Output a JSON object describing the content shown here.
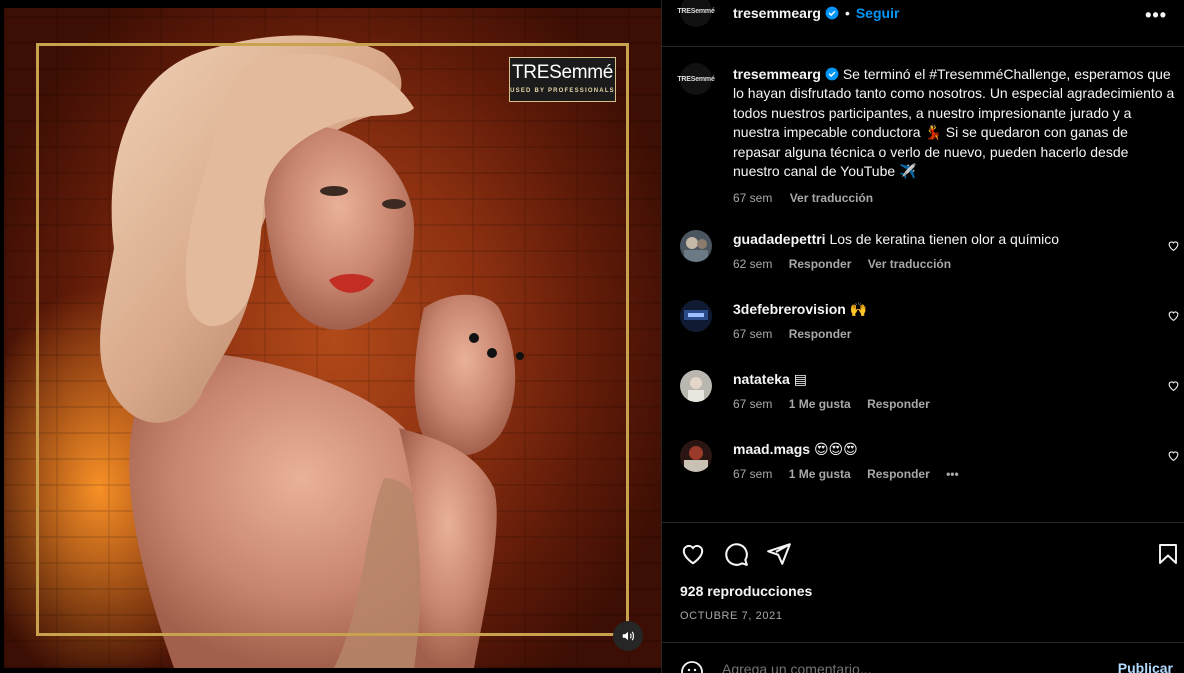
{
  "post": {
    "brand_logo_text": "TRESemmé",
    "brand_logo_tag": "USED BY PROFESSIONALS",
    "username": "tresemmearg",
    "follow_label": "Seguir",
    "more_label": "•••",
    "avatar_text": "TRESemmé"
  },
  "caption": {
    "username": "tresemmearg",
    "text": "Se terminó el #TresemméChallenge, esperamos que lo hayan disfrutado tanto como nosotros. Un especial agradecimiento a todos nuestros participantes, a nuestro impresionante jurado y a nuestra impecable conductora 💃 Si se quedaron con ganas de repasar alguna técnica o verlo de nuevo, pueden hacerlo desde nuestro canal de YouTube ✈️",
    "time": "67 sem",
    "translate_label": "Ver traducción"
  },
  "comments": [
    {
      "username": "guadadepettri",
      "text": "Los de keratina tienen olor a químico",
      "time": "62 sem",
      "likes": "",
      "reply_label": "Responder",
      "translate_label": "Ver traducción",
      "avatar_color": "#4a5560"
    },
    {
      "username": "3defebrerovision",
      "text": "🙌",
      "time": "67 sem",
      "likes": "",
      "reply_label": "Responder",
      "translate_label": "",
      "avatar_color": "#1d2a4a"
    },
    {
      "username": "natateka",
      "text": "▤",
      "time": "67 sem",
      "likes": "1 Me gusta",
      "reply_label": "Responder",
      "translate_label": "",
      "avatar_color": "#9a9a96"
    },
    {
      "username": "maad.mags",
      "text": "😍😍😍",
      "time": "67 sem",
      "likes": "1 Me gusta",
      "reply_label": "Responder",
      "translate_label": "",
      "avatar_color": "#7a2a20",
      "more": "•••"
    }
  ],
  "stats": {
    "views": "928 reproducciones",
    "date": "OCTUBRE 7, 2021"
  },
  "add_comment": {
    "placeholder": "Agrega un comentario...",
    "publish_label": "Publicar"
  },
  "icons": {
    "like": "heart-icon",
    "comment": "comment-icon",
    "share": "send-icon",
    "save": "bookmark-icon",
    "mute": "speaker-icon",
    "emoji": "emoji-icon"
  },
  "colors": {
    "accent": "#0095f6",
    "brand_gold": "#c9a24e",
    "muted_text": "#a8a8a8",
    "divider": "#262626"
  }
}
